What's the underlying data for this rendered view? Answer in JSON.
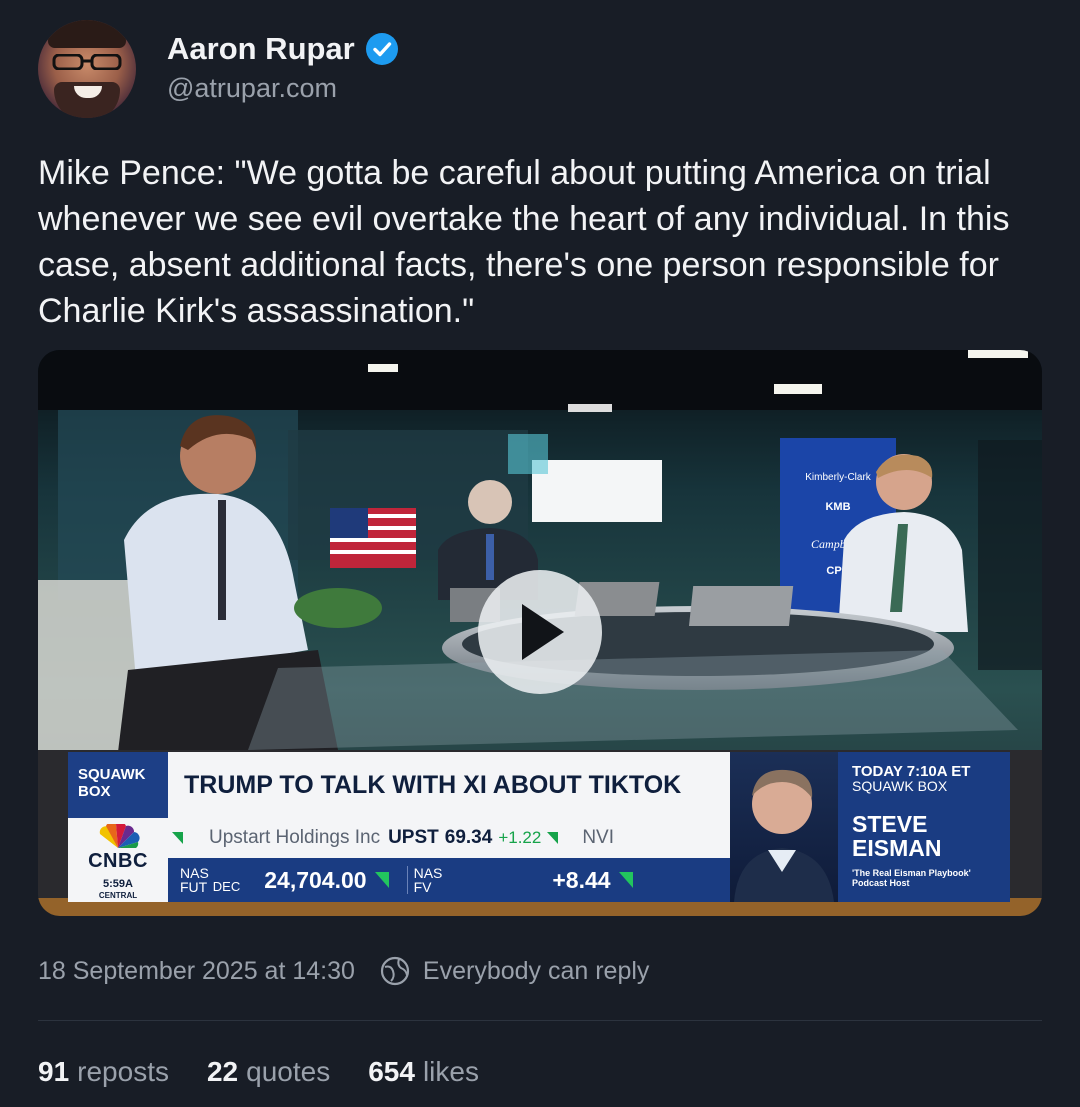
{
  "author": {
    "name": "Aaron Rupar",
    "handle": "@atrupar.com",
    "verified": true,
    "verified_color": "#1d9bf0"
  },
  "post": {
    "text": "Mike Pence: \"We gotta be careful about putting America on trial whenever we see evil overtake the heart of any individual. In this case, absent additional facts, there's one person responsible for Charlie Kirk's assassination.\""
  },
  "video": {
    "show_label_line1": "SQUAWK",
    "show_label_line2": "BOX",
    "headline": "TRUMP TO TALK WITH XI ABOUT TIKTOK",
    "network": "CNBC",
    "clock_time": "5:59A",
    "clock_zone": "CENTRAL",
    "stock_name": "Upstart Holdings Inc",
    "stock_symbol": "UPST",
    "stock_price": "69.34",
    "stock_change": "+1.22",
    "next_symbol": "NVI",
    "fut_label_1": "NAS",
    "fut_label_2": "FUT",
    "fut_month": "DEC",
    "fut_value": "24,704.00",
    "fv_label_1": "NAS",
    "fv_label_2": "FV",
    "fv_value": "+8.44",
    "promo_time": "TODAY 7:10A ET",
    "promo_show": "SQUAWK BOX",
    "guest_first": "STEVE",
    "guest_last": "EISMAN",
    "guest_title_1": "'The Real Eisman Playbook'",
    "guest_title_2": "Podcast Host",
    "wall_brand_1": "Kimberly-Clark",
    "wall_ticker_1": "KMB",
    "wall_brand_2": "Campbell's",
    "wall_ticker_2": "CPB"
  },
  "meta": {
    "timestamp": "18 September 2025 at 14:30",
    "reply_setting": "Everybody can reply"
  },
  "stats": {
    "reposts_count": "91",
    "reposts_label": "reposts",
    "quotes_count": "22",
    "quotes_label": "quotes",
    "likes_count": "654",
    "likes_label": "likes"
  },
  "colors": {
    "background": "#181d26",
    "text": "#f2f3f5",
    "muted": "#9aa1ab",
    "cnbc_blue": "#1a3c82",
    "ticker_green": "#16a34a"
  }
}
